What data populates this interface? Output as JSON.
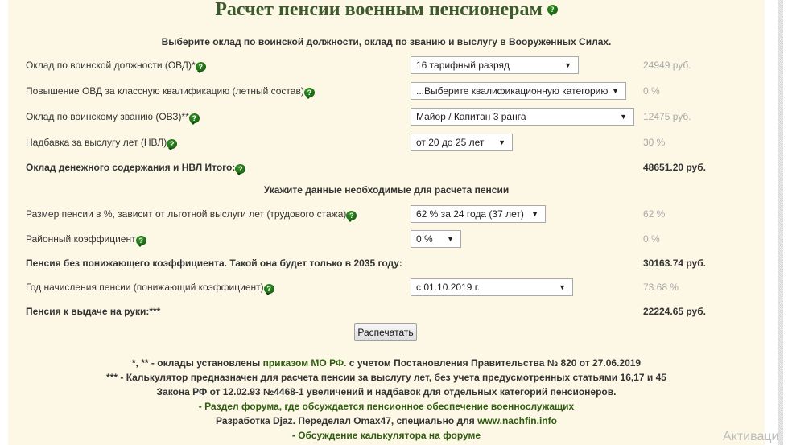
{
  "title": "Расчет пенсии военным пенсионерам",
  "help_icon_glyph": "?",
  "section1_heading": "Выберите оклад по воинской должности, оклад по званию и выслугу в Вооруженных Силах.",
  "rows1": [
    {
      "label": "Оклад по воинской должности (ОВД)*",
      "select": "16 тарифный разряд",
      "value": "24949 руб."
    },
    {
      "label": "Повышение ОВД за классную квалификацию (летный состав)",
      "select": "...Выберите квалификационную категорию",
      "value": "0 %"
    },
    {
      "label": "Оклад по воинскому званию (ОВЗ)**",
      "select": "Майор / Капитан 3 ранга",
      "value": "12475 руб."
    },
    {
      "label": "Надбавка за выслугу лет (НВЛ)",
      "select": "от 20 до 25 лет",
      "value": "30 %"
    }
  ],
  "total1": {
    "label": "Оклад денежного содержания и НВЛ Итого:",
    "value": "48651.20 руб."
  },
  "section2_heading": "Укажите данные необходимые для расчета пенсии",
  "rows2": [
    {
      "label": "Размер пенсии в %, зависит от льготной выслуги лет (трудового стажа)",
      "select": "62 % за 24 года (37 лет)",
      "value": "62 %"
    },
    {
      "label": "Районный коэффициент",
      "select": "0 %",
      "value": "0 %"
    }
  ],
  "pension_no_coef": {
    "label": "Пенсия без понижающего коэффициента. Такой она будет только в 2035 году:",
    "value": "30163.74 руб."
  },
  "year_row": {
    "label": "Год начисления пенсии (понижающий коэффициент)",
    "select": "с 01.10.2019 г.",
    "value": "73.68 %"
  },
  "pension_final": {
    "label": "Пенсия к выдаче на руки:***",
    "value": "22224.65 руб."
  },
  "print_button": "Распечатать",
  "footer": {
    "line1_prefix": "*, ** - оклады установлены ",
    "line1_link": "приказом МО РФ.",
    "line1_suffix": " с учетом Постановления Правительства № 820 от 27.06.2019",
    "line2": "*** - Калькулятор предназначен для расчета пенсии за выслугу лет, без учета предусмотренных статьями 16,17 и 45",
    "line3": "Закона РФ от 12.02.93 №4468-1 увеличений и надбавок для отдельных категорий пенсионеров.",
    "line4_link": "- Раздел форума, где обсуждается пенсионное обеспечение военнослужащих",
    "line5_prefix": "Разработка Djaz. Переделал Omax47, специально для ",
    "line5_link": "www.nachfin.info",
    "line6_link": "- Обсуждение калькулятора на форуме"
  },
  "watermark": "Активаци"
}
